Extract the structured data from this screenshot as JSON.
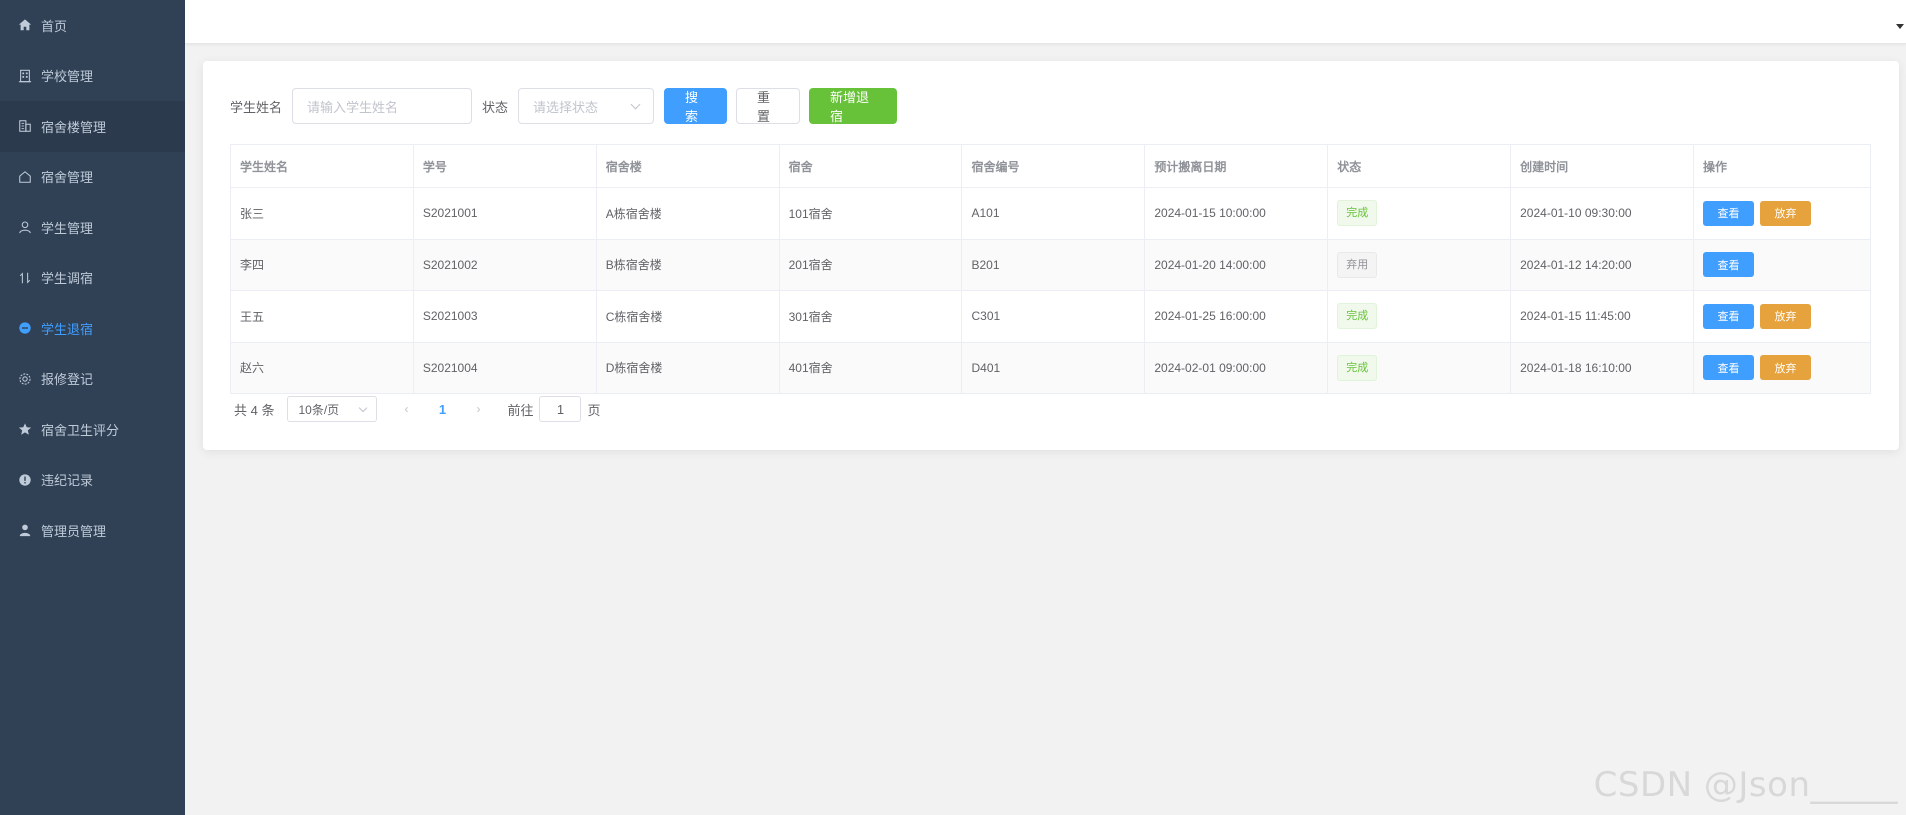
{
  "sidebar": {
    "items": [
      {
        "label": "首页"
      },
      {
        "label": "学校管理"
      },
      {
        "label": "宿舍楼管理"
      },
      {
        "label": "宿舍管理"
      },
      {
        "label": "学生管理"
      },
      {
        "label": "学生调宿"
      },
      {
        "label": "学生退宿"
      },
      {
        "label": "报修登记"
      },
      {
        "label": "宿舍卫生评分"
      },
      {
        "label": "违纪记录"
      },
      {
        "label": "管理员管理"
      }
    ],
    "active_index": 6,
    "hover_index": 2
  },
  "search": {
    "name_label": "学生姓名",
    "name_placeholder": "请输入学生姓名",
    "status_label": "状态",
    "status_placeholder": "请选择状态",
    "search_label": "搜索",
    "reset_label": "重置",
    "add_label": "新增退宿"
  },
  "table": {
    "headers": [
      "学生姓名",
      "学号",
      "宿舍楼",
      "宿舍",
      "宿舍编号",
      "预计搬离日期",
      "状态",
      "创建时间",
      "操作"
    ],
    "rows": [
      {
        "name": "张三",
        "id": "S2021001",
        "building": "A栋宿舍楼",
        "room": "101宿舍",
        "code": "A101",
        "leave_date": "2024-01-15 10:00:00",
        "status": "完成",
        "created": "2024-01-10 09:30:00",
        "view": "查看",
        "abandon": "放弃"
      },
      {
        "name": "李四",
        "id": "S2021002",
        "building": "B栋宿舍楼",
        "room": "201宿舍",
        "code": "B201",
        "leave_date": "2024-01-20 14:00:00",
        "status": "弃用",
        "created": "2024-01-12 14:20:00",
        "view": "查看",
        "abandon": ""
      },
      {
        "name": "王五",
        "id": "S2021003",
        "building": "C栋宿舍楼",
        "room": "301宿舍",
        "code": "C301",
        "leave_date": "2024-01-25 16:00:00",
        "status": "完成",
        "created": "2024-01-15 11:45:00",
        "view": "查看",
        "abandon": "放弃"
      },
      {
        "name": "赵六",
        "id": "S2021004",
        "building": "D栋宿舍楼",
        "room": "401宿舍",
        "code": "D401",
        "leave_date": "2024-02-01 09:00:00",
        "status": "完成",
        "created": "2024-01-18 16:10:00",
        "view": "查看",
        "abandon": "放弃"
      }
    ]
  },
  "pagination": {
    "total": "共 4 条",
    "page_size": "10条/页",
    "current_page": "1",
    "goto_label": "前往",
    "goto_value": "1",
    "page_suffix": "页"
  },
  "watermark": "CSDN @Json_____",
  "colors": {
    "sidebar_bg": "#304156",
    "primary": "#409eff",
    "success": "#67c23a",
    "warning": "#e6a23c"
  },
  "icons": [
    "home-icon",
    "school-icon",
    "building-icon",
    "house-icon",
    "user-icon",
    "transfer-icon",
    "minus-circle-icon",
    "gear-icon",
    "star-icon",
    "warning-circle-icon",
    "admin-icon"
  ]
}
